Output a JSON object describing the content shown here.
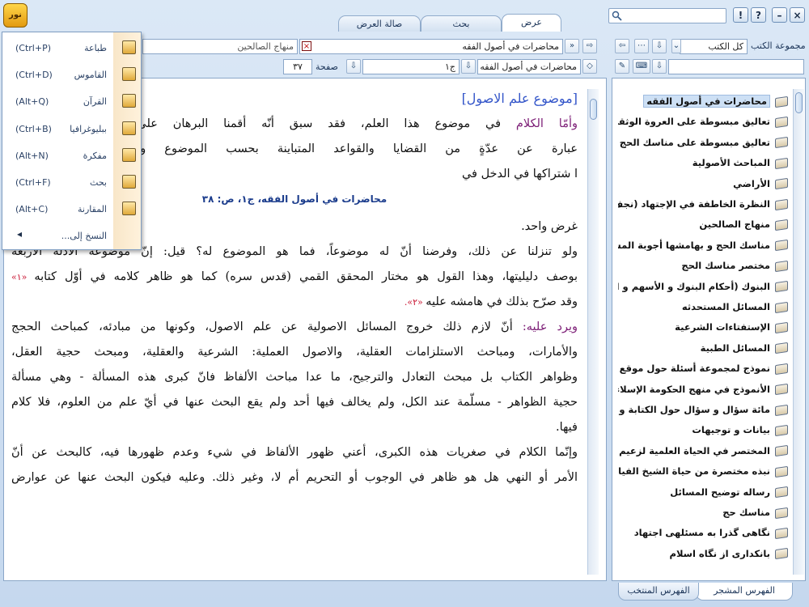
{
  "window": {
    "logo_glyph": "نور",
    "controls": [
      "×",
      "–",
      "?",
      "!"
    ]
  },
  "tabs": [
    "عرض",
    "بحث",
    "صالة العرض"
  ],
  "menu": {
    "items": [
      {
        "label": "طباعة",
        "shortcut": "(Ctrl+P)",
        "icon": "printer-icon"
      },
      {
        "label": "القاموس",
        "shortcut": "(Ctrl+D)",
        "icon": "dictionary-icon"
      },
      {
        "label": "القرآن",
        "shortcut": "(Alt+Q)",
        "icon": "quran-icon"
      },
      {
        "label": "ببليوغرافيا",
        "shortcut": "(Ctrl+B)",
        "icon": "bibliography-icon"
      },
      {
        "label": "مفكرة",
        "shortcut": "(Alt+N)",
        "icon": "notepad-icon"
      },
      {
        "label": "بحث",
        "shortcut": "(Ctrl+F)",
        "icon": "search-icon"
      },
      {
        "label": "المقارنة",
        "shortcut": "(Alt+C)",
        "icon": "compare-icon"
      },
      {
        "label": "النسخ إلى...",
        "shortcut": "",
        "icon": "arrow-left-icon"
      }
    ]
  },
  "doc_tabs": {
    "active": "محاضرات في أصول الفقه",
    "other": "منهاج الصالحين"
  },
  "nav": {
    "book_field": "محاضرات في أصول الفقه",
    "volume_field": "ج۱",
    "page_label": "صفحة",
    "page_field": "۳۷"
  },
  "sidebar": {
    "title": "مجموعة الكتب",
    "collection_value": "كل الكتب",
    "books": [
      "محاضرات في أصول الفقه",
      "تعاليق مبسوطة على العروة الوثقى",
      "تعاليق مبسوطة على مناسك الحج",
      "المباحث الأصولية",
      "الأراضي",
      "النظرة الخاطفة في الإجتهاد (نجف",
      "منهاج الصالحين",
      "مناسك الحج و بهامشها أجوبة المس",
      "مختصر مناسك الحج",
      "البنوك (أحكام البنوك و الأسهم و ا",
      "المسائل المستحدثه",
      "الإستفتاءات الشرعية",
      "المسائل الطبية",
      "نموذج لمجموعة أسئلة حول موقع ا",
      "الأنموذج في منهج الحكومة الإسلاء",
      "مائة سؤال و سؤال حول الكتابة و ال",
      "بيانات و توجيهات",
      "المختصر في الحياة العلمية لزعيم ا",
      "نبذه مختصرة من حياة الشيخ الفياء",
      "رساله توضيح المسائل",
      "مناسك حج",
      "نگاهى گذرا به مسئلهی اجتهاد",
      "بانكدارى از نگاه اسلام"
    ],
    "bottom_tabs": [
      "الفهرس المشجر",
      "الفهرس المنتخب"
    ]
  },
  "content": {
    "heading": "[موضوع علم الاصول]",
    "citation": "محاضرات في أصول الفقه، ج۱، ص: ۳۸",
    "p1_lead": "وأمّا الكلام",
    "p1_rest": " في موضوع هذا العلم، فقد سبق أنّه أقمنا البرهان على أنّه لا موضوع له",
    "p2": "عبارة عن عدّةٍ من القضايا والقواعد المتباينة بحسب الموضوع والمحمول التي جمعها",
    "p3": "ا شتراكها في الدخل في",
    "p4": "غرض واحد.",
    "p5": "ولو تنزلنا عن ذلك، وفرضنا أنّ له موضوعاً، فما هو الموضوع له؟ قيل: إنّ موضوعه الأدلة الأربعة",
    "p6_text": "بوصف دليليتها، وهذا القول هو مختار المحقق القمي (قدس سره) كما هو ظاهر كلامه في أوّل كتابه",
    "p6_ref": " «۱»",
    "p7_text": "وقد صرّح بذلك في هامشه عليه",
    "p7_ref": " «۲».",
    "p8_lead": "ويرد عليه: ",
    "p8_rest": "أنّ لازم ذلك خروج المسائل الاصولية عن علم الاصول، وكونها من مبادئه، كمباحث الحجج",
    "p9": "والأمارات، ومباحث الاستلزامات العقلية، والاصول العملية: الشرعية والعقلية، ومبحث حجية العقل،",
    "p10": "وظواهر الكتاب بل مبحث التعادل والترجيح، ما عدا مباحث الألفاظ فانّ كبرى هذه المسألة - وهي مسألة",
    "p11": "حجية الظواهر - مسلّمة عند الكل، ولم يخالف فيها أحد ولم يقع البحث عنها في أيّ علم من العلوم، فلا كلام",
    "p12": "فيها.",
    "p13": "وإنّما الكلام في صغريات هذه الكبرى، أعني ظهور الألفاظ في شيء وعدم ظهورها فيه، كالبحث عن أنّ",
    "p14": "الأمر أو النهي هل هو ظاهر في الوجوب أو التحريم أم لا، وغير ذلك. وعليه فيكون البحث عنها عن عوارض"
  },
  "colors": {
    "heading": "#3355c9",
    "lead": "#7d1f77",
    "ref": "#c8102e",
    "citation": "#1b3c8c"
  }
}
